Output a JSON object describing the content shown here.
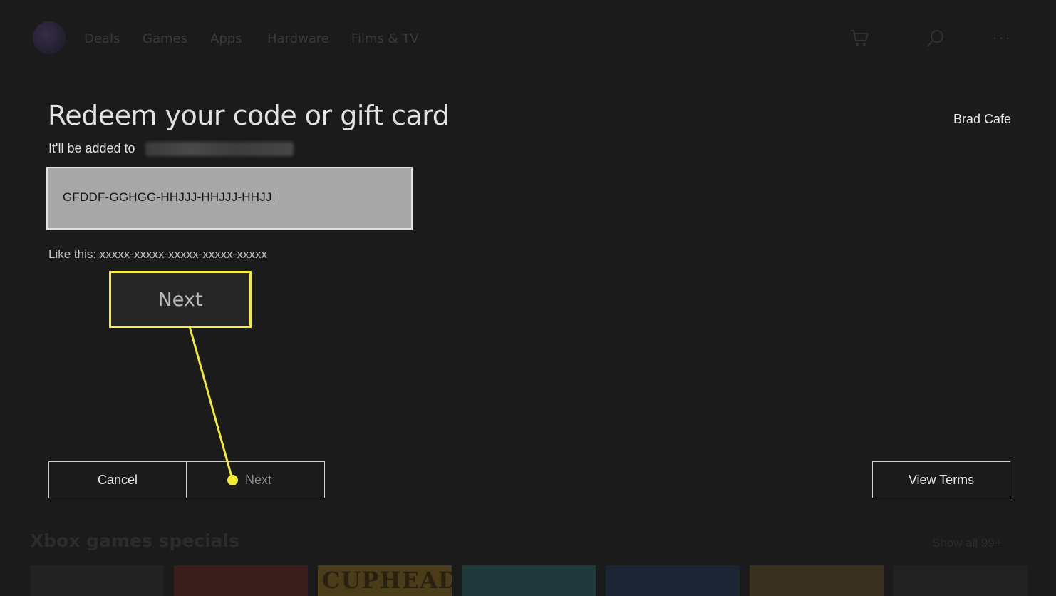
{
  "nav": {
    "items": [
      "Deals",
      "Games",
      "Apps",
      "Hardware",
      "Films & TV"
    ],
    "icons": [
      "avatar",
      "cart-icon",
      "search-icon",
      "more-icon"
    ]
  },
  "dialog": {
    "title": "Redeem your code or gift card",
    "username": "Brad Cafe",
    "added_to_label": "It'll be added to",
    "code_value": "GFDDF-GGHGG-HHJJJ-HHJJJ-HHJJ",
    "hint": "Like this: xxxxx-xxxxx-xxxxx-xxxxx-xxxxx",
    "callout_label": "Next"
  },
  "buttons": {
    "cancel": "Cancel",
    "next": "Next",
    "view_terms": "View Terms"
  },
  "section": {
    "title": "Xbox games specials",
    "show_all": "Show all 99+",
    "tiles": [
      {
        "label": "",
        "color": "#232323"
      },
      {
        "label": "",
        "color": "#3a1e1e"
      },
      {
        "label": "CUPHEAD",
        "color": "#4a3c18"
      },
      {
        "label": "",
        "color": "#1e3a3a"
      },
      {
        "label": "",
        "color": "#1c2533"
      },
      {
        "label": "",
        "color": "#3a3020"
      },
      {
        "label": "",
        "color": "#222222"
      }
    ]
  },
  "colors": {
    "accent_highlight": "#f3ea33",
    "background": "#1b1b1b",
    "input_fill": "#a8a8a8"
  }
}
